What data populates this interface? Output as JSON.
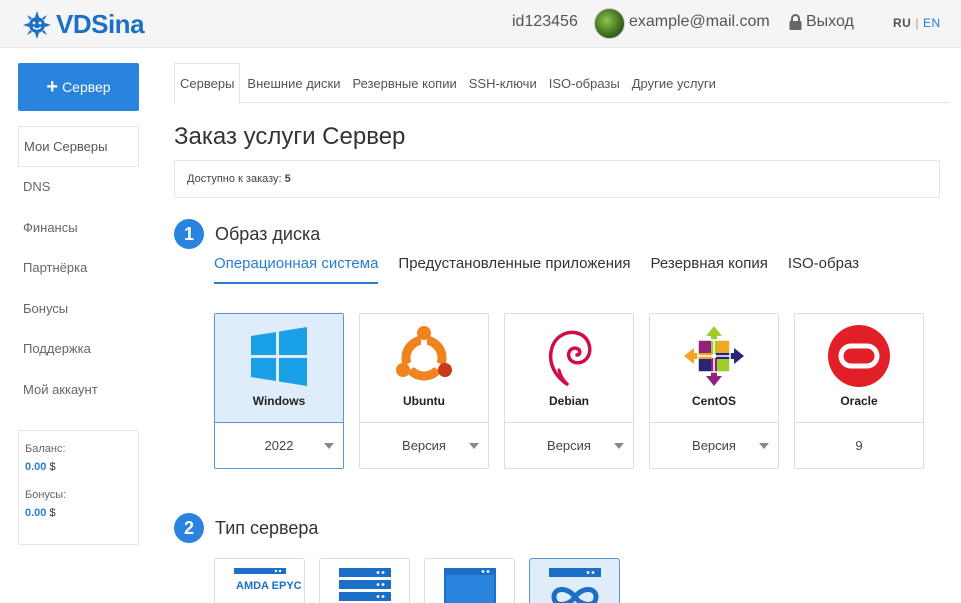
{
  "header": {
    "logo_text": "VDSina",
    "user_id": "id123456",
    "email": "example@mail.com",
    "logout_label": "Выход",
    "lang_ru": "RU",
    "lang_sep": "|",
    "lang_en": "EN"
  },
  "sidebar": {
    "new_server_label": "Сервер",
    "items": [
      {
        "label": "Мои Серверы"
      },
      {
        "label": "DNS"
      },
      {
        "label": "Финансы"
      },
      {
        "label": "Партнёрка"
      },
      {
        "label": "Бонусы"
      },
      {
        "label": "Поддержка"
      },
      {
        "label": "Мой аккаунт"
      }
    ],
    "balance_label": "Баланс:",
    "balance_value": "0.00",
    "bonus_label": "Бонусы:",
    "bonus_value": "0.00",
    "currency": "$"
  },
  "tabs": [
    {
      "label": "Серверы"
    },
    {
      "label": "Внешние диски"
    },
    {
      "label": "Резервные копии"
    },
    {
      "label": "SSH-ключи"
    },
    {
      "label": "ISO-образы"
    },
    {
      "label": "Другие услуги"
    }
  ],
  "main": {
    "title": "Заказ услуги Сервер",
    "available_label": "Доступно к заказу:",
    "available_count": "5",
    "step1": {
      "num": "1",
      "title": "Образ диска"
    },
    "step2": {
      "num": "2",
      "title": "Тип сервера"
    },
    "os_tabs": [
      {
        "label": "Операционная система"
      },
      {
        "label": "Предустановленные приложения"
      },
      {
        "label": "Резервная копия"
      },
      {
        "label": "ISO-образ"
      }
    ],
    "os_cards": [
      {
        "name": "Windows",
        "version": "2022"
      },
      {
        "name": "Ubuntu",
        "version": "Версия"
      },
      {
        "name": "Debian",
        "version": "Версия"
      },
      {
        "name": "CentOS",
        "version": "Версия"
      },
      {
        "name": "Oracle",
        "version": "9"
      }
    ],
    "server_types": [
      {
        "logo_text": "AMDA EPYC"
      }
    ]
  },
  "colors": {
    "accent": "#2a84de",
    "link": "#2a7dd6",
    "selected_bg": "#dfecfa"
  }
}
